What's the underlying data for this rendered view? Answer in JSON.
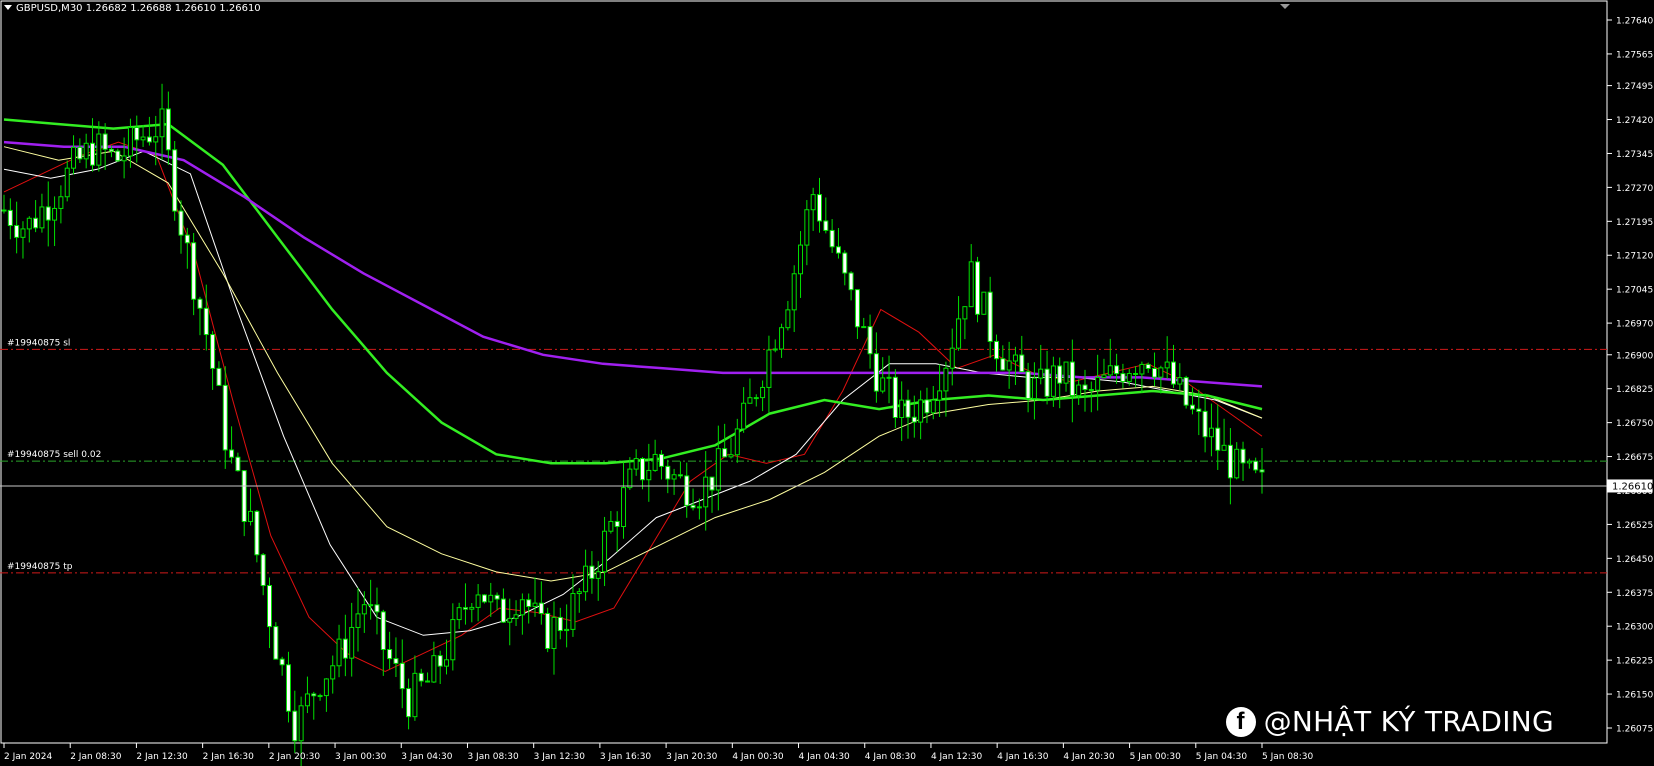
{
  "chart_title": "GBPUSD,M30  1.26682 1.26688 1.26610 1.26610",
  "current_price_label": "1.26610",
  "watermark": {
    "brand_icon": "facebook-icon",
    "text": "@NHẬT KÝ TRADING"
  },
  "order_lines": [
    {
      "label": "#19940875 sl",
      "price": 1.26912,
      "color": "#d11a1a"
    },
    {
      "label": "#19940875 sell 0.02",
      "price": 1.26665,
      "color": "#2aa52a"
    },
    {
      "label": "#19940875 tp",
      "price": 1.26418,
      "color": "#d11a1a"
    }
  ],
  "chart_data": {
    "type": "candlestick",
    "symbol": "GBPUSD",
    "timeframe": "M30",
    "y_ticks": [
      1.2764,
      1.27565,
      1.27495,
      1.2742,
      1.27345,
      1.2727,
      1.27195,
      1.2712,
      1.27045,
      1.2697,
      1.269,
      1.26825,
      1.2675,
      1.26675,
      1.266,
      1.26525,
      1.2645,
      1.26375,
      1.263,
      1.26225,
      1.2615,
      1.26075
    ],
    "y_tick_labels": [
      "1.27640",
      "1.27565",
      "1.27495",
      "1.27420",
      "1.27345",
      "1.27270",
      "1.27195",
      "1.27120",
      "1.27045",
      "1.26970",
      "1.26900",
      "1.26825",
      "1.26750",
      "1.26675",
      "1.26600",
      "1.26525",
      "1.26450",
      "1.26375",
      "1.26300",
      "1.26225",
      "1.26150",
      "1.26075"
    ],
    "x_tick_labels": [
      "2 Jan 2024",
      "2 Jan 08:30",
      "2 Jan 12:30",
      "2 Jan 16:30",
      "2 Jan 20:30",
      "3 Jan 00:30",
      "3 Jan 04:30",
      "3 Jan 08:30",
      "3 Jan 12:30",
      "3 Jan 16:30",
      "3 Jan 20:30",
      "4 Jan 00:30",
      "4 Jan 04:30",
      "4 Jan 08:30",
      "4 Jan 12:30",
      "4 Jan 16:30",
      "4 Jan 20:30",
      "5 Jan 00:30",
      "5 Jan 04:30",
      "5 Jan 08:30"
    ],
    "ylim": [
      1.26045,
      1.2769
    ],
    "close_path": [
      1.2722,
      1.2718,
      1.2724,
      1.2731,
      1.2736,
      1.2733,
      1.2738,
      1.2741,
      1.2716,
      1.2695,
      1.2668,
      1.2652,
      1.2628,
      1.2608,
      1.2618,
      1.2624,
      1.2636,
      1.2624,
      1.2614,
      1.2618,
      1.2628,
      1.264,
      1.2632,
      1.2638,
      1.2628,
      1.2632,
      1.264,
      1.2652,
      1.2663,
      1.2667,
      1.2662,
      1.266,
      1.2666,
      1.2676,
      1.269,
      1.2705,
      1.2726,
      1.2712,
      1.2698,
      1.2684,
      1.2676,
      1.268,
      1.269,
      1.2708,
      1.2694,
      1.2686,
      1.2682,
      1.2686,
      1.268,
      1.2684,
      1.2688,
      1.269,
      1.2684,
      1.2676,
      1.267,
      1.2664,
      1.2661
    ],
    "series": [
      {
        "name": "",
        "color": "#e01010",
        "values": [
          1.2726,
          1.273,
          1.2734,
          1.2737,
          1.2734,
          1.2712,
          1.268,
          1.265,
          1.2632,
          1.2624,
          1.262,
          1.2624,
          1.2628,
          1.2634,
          1.2633,
          1.2631,
          1.2634,
          1.2648,
          1.2662,
          1.2668,
          1.2666,
          1.2668,
          1.2682,
          1.27,
          1.2695,
          1.2687,
          1.269,
          1.2686,
          1.2684,
          1.2686,
          1.2688,
          1.2684,
          1.2678,
          1.2672
        ]
      },
      {
        "name": "",
        "color": "#ffffff",
        "values": [
          1.2731,
          1.2729,
          1.2731,
          1.2735,
          1.273,
          1.27,
          1.2672,
          1.2648,
          1.2632,
          1.2628,
          1.2629,
          1.2632,
          1.2637,
          1.2645,
          1.2654,
          1.2658,
          1.2662,
          1.2668,
          1.268,
          1.2688,
          1.2688,
          1.2686,
          1.2685,
          1.2685,
          1.2684,
          1.2682,
          1.268,
          1.2676
        ]
      },
      {
        "name": "",
        "color": "#ffffa0",
        "values": [
          1.2736,
          1.2733,
          1.2735,
          1.2728,
          1.2708,
          1.2686,
          1.2666,
          1.2652,
          1.2646,
          1.2642,
          1.264,
          1.2642,
          1.2648,
          1.2654,
          1.2658,
          1.2664,
          1.2672,
          1.2677,
          1.2679,
          1.268,
          1.2682,
          1.2683,
          1.2681,
          1.2676
        ]
      },
      {
        "name": "",
        "color": "#33ee22",
        "values": [
          1.2742,
          1.2741,
          1.274,
          1.2741,
          1.2732,
          1.2716,
          1.27,
          1.2686,
          1.2675,
          1.2668,
          1.2666,
          1.2666,
          1.2667,
          1.267,
          1.2677,
          1.268,
          1.2678,
          1.268,
          1.2681,
          1.268,
          1.2681,
          1.2682,
          1.2681,
          1.2678
        ]
      },
      {
        "name": "",
        "color": "#a020f0",
        "values": [
          1.2737,
          1.2736,
          1.2736,
          1.2733,
          1.2725,
          1.2716,
          1.2708,
          1.2701,
          1.2694,
          1.269,
          1.2688,
          1.2687,
          1.2686,
          1.2686,
          1.2686,
          1.2686,
          1.2686,
          1.2686,
          1.2685,
          1.2685,
          1.2684,
          1.2683
        ]
      }
    ]
  }
}
